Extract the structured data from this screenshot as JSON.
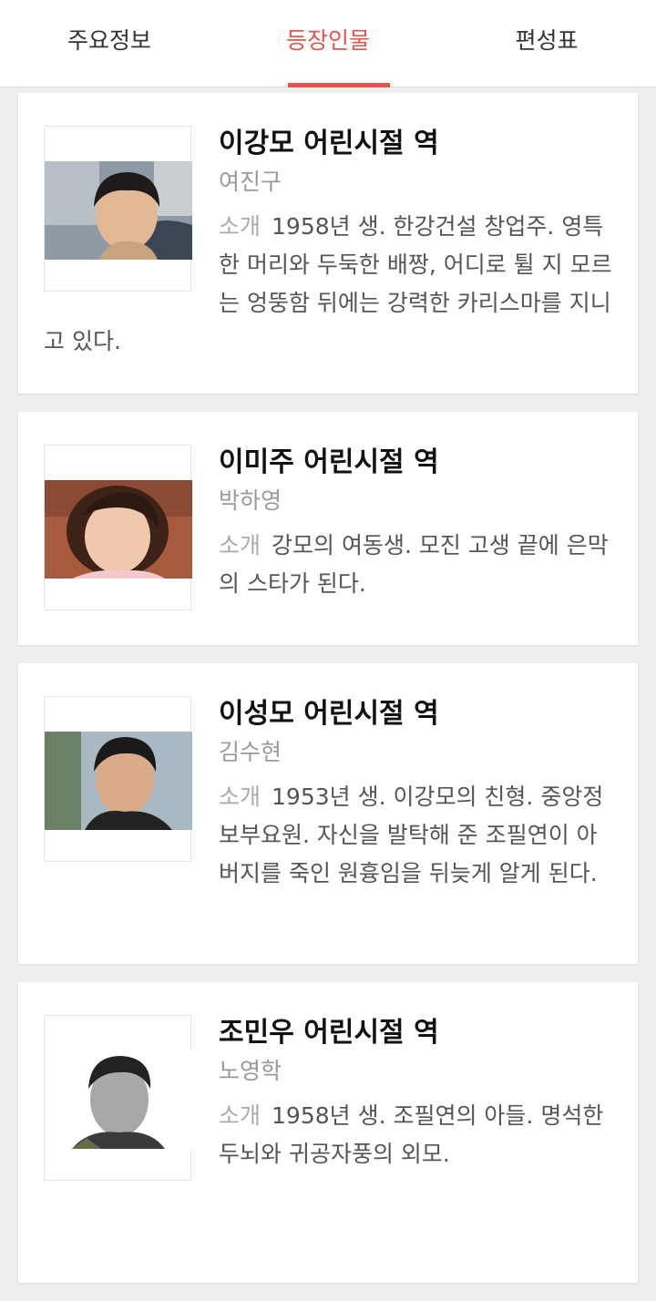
{
  "tabs": [
    {
      "label": "주요정보",
      "active": false
    },
    {
      "label": "등장인물",
      "active": true
    },
    {
      "label": "편성표",
      "active": false
    }
  ],
  "accent_color": "#e2554f",
  "characters": [
    {
      "role": "이강모 어린시절 역",
      "actor": "여진구",
      "desc_label": "소개",
      "desc": "1958년 생. 한강건설 창업주. 영특한 머리와 두둑한 배짱, 어디로 튈 지 모르는 엉뚱함 뒤에는 강력한 카리스마를 지니고 있다."
    },
    {
      "role": "이미주 어린시절 역",
      "actor": "박하영",
      "desc_label": "소개",
      "desc": "강모의 여동생. 모진 고생 끝에 은막의 스타가 된다."
    },
    {
      "role": "이성모 어린시절 역",
      "actor": "김수현",
      "desc_label": "소개",
      "desc": "1953년 생. 이강모의 친형. 중앙정보부요원. 자신을 발탁해 준 조필연이 아버지를 죽인 원흉임을 뒤늦게 알게 된다."
    },
    {
      "role": "조민우 어린시절 역",
      "actor": "노영학",
      "desc_label": "소개",
      "desc": "1958년 생. 조필연의 아들. 명석한 두뇌와 귀공자풍의 외모."
    }
  ]
}
